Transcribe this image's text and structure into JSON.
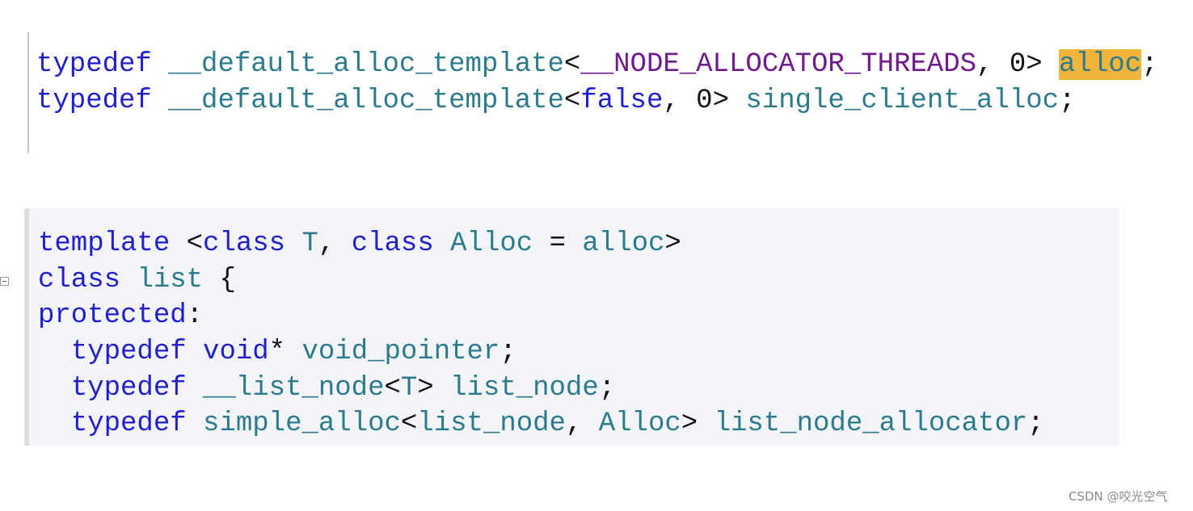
{
  "code_block_1": {
    "lines": [
      [
        [
          "kw",
          "typedef"
        ],
        [
          "pl",
          " "
        ],
        [
          "ty",
          "__default_alloc_template"
        ],
        [
          "pl",
          "<"
        ],
        [
          "mac",
          "__NODE_ALLOCATOR_THREADS"
        ],
        [
          "pl",
          ", 0> "
        ],
        [
          "hl",
          "alloc"
        ],
        [
          "pl",
          ";"
        ]
      ],
      [
        [
          "kw",
          "typedef"
        ],
        [
          "pl",
          " "
        ],
        [
          "ty",
          "__default_alloc_template"
        ],
        [
          "pl",
          "<"
        ],
        [
          "kw",
          "false"
        ],
        [
          "pl",
          ", 0> "
        ],
        [
          "ty",
          "single_client_alloc"
        ],
        [
          "pl",
          ";"
        ]
      ]
    ]
  },
  "code_block_2": {
    "lines": [
      [
        [
          "kw",
          "template"
        ],
        [
          "pl",
          " <"
        ],
        [
          "kw",
          "class"
        ],
        [
          "pl",
          " "
        ],
        [
          "ty",
          "T"
        ],
        [
          "pl",
          ", "
        ],
        [
          "kw",
          "class"
        ],
        [
          "pl",
          " "
        ],
        [
          "ty",
          "Alloc"
        ],
        [
          "pl",
          " = "
        ],
        [
          "ty",
          "alloc"
        ],
        [
          "pl",
          ">"
        ]
      ],
      [
        [
          "kw",
          "class"
        ],
        [
          "pl",
          " "
        ],
        [
          "ty",
          "list"
        ],
        [
          "pl",
          " {"
        ]
      ],
      [
        [
          "kw",
          "protected"
        ],
        [
          "pl",
          ":"
        ]
      ],
      [
        [
          "pl",
          "  "
        ],
        [
          "kw",
          "typedef"
        ],
        [
          "pl",
          " "
        ],
        [
          "kw",
          "void"
        ],
        [
          "pl",
          "* "
        ],
        [
          "ty",
          "void_pointer"
        ],
        [
          "pl",
          ";"
        ]
      ],
      [
        [
          "pl",
          "  "
        ],
        [
          "kw",
          "typedef"
        ],
        [
          "pl",
          " "
        ],
        [
          "ty",
          "__list_node"
        ],
        [
          "pl",
          "<"
        ],
        [
          "ty",
          "T"
        ],
        [
          "pl",
          "> "
        ],
        [
          "ty",
          "list_node"
        ],
        [
          "pl",
          ";"
        ]
      ],
      [
        [
          "pl",
          "  "
        ],
        [
          "kw",
          "typedef"
        ],
        [
          "pl",
          " "
        ],
        [
          "ty",
          "simple_alloc"
        ],
        [
          "pl",
          "<"
        ],
        [
          "ty",
          "list_node"
        ],
        [
          "pl",
          ", "
        ],
        [
          "ty",
          "Alloc"
        ],
        [
          "pl",
          "> "
        ],
        [
          "ty",
          "list_node_allocator"
        ],
        [
          "pl",
          ";"
        ]
      ]
    ]
  },
  "icons": {
    "fold": "collapse-minus-icon"
  },
  "colors": {
    "keyword": "#1f1fcf",
    "type": "#2b7b8c",
    "macro": "#6f1a8e",
    "highlight": "#f3b43c"
  },
  "watermark": "CSDN @咬光空气"
}
